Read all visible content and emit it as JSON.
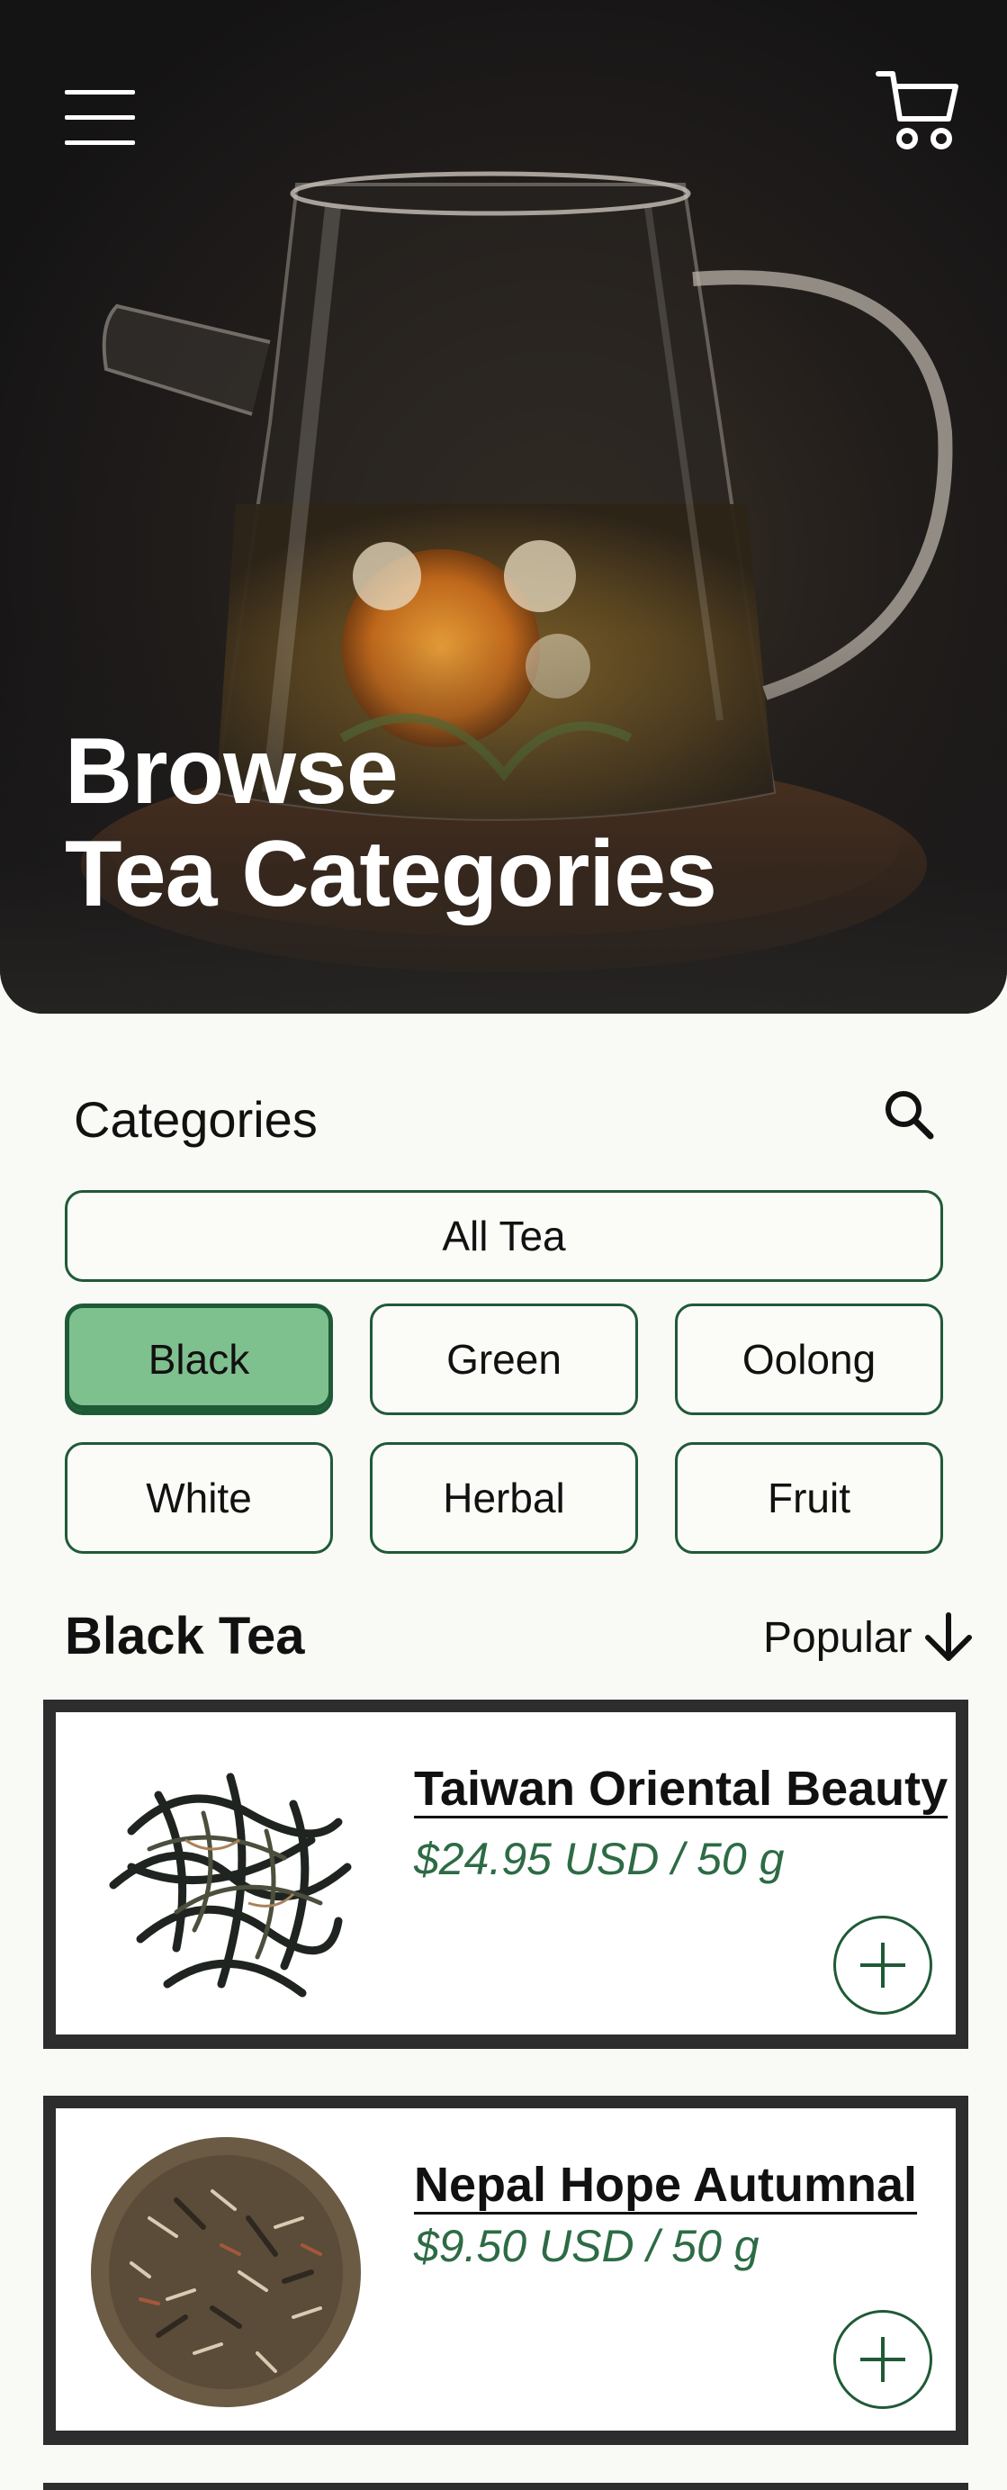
{
  "hero": {
    "title_line1": "Browse",
    "title_line2": "Tea Categories"
  },
  "header": {
    "menu_icon": "hamburger-menu-icon",
    "cart_icon": "shopping-cart-icon"
  },
  "categories": {
    "title": "Categories",
    "search_icon": "search-icon",
    "all_label": "All Tea",
    "items": [
      {
        "label": "Black",
        "active": true
      },
      {
        "label": "Green",
        "active": false
      },
      {
        "label": "Oolong",
        "active": false
      },
      {
        "label": "White",
        "active": false
      },
      {
        "label": "Herbal",
        "active": false
      },
      {
        "label": "Fruit",
        "active": false
      }
    ]
  },
  "listing": {
    "section_title": "Black Tea",
    "sort_label": "Popular",
    "sort_icon": "arrow-down-icon"
  },
  "products": [
    {
      "name": "Taiwan Oriental Beauty",
      "price": "$24.95 USD / 50 g"
    },
    {
      "name": "Nepal Hope Autumnal",
      "price": "$9.50 USD / 50 g"
    }
  ],
  "colors": {
    "accent_green": "#1f5a37",
    "active_pill": "#7fc08f",
    "price_green": "#2d6b45",
    "hero_dark": "#1a1818"
  }
}
